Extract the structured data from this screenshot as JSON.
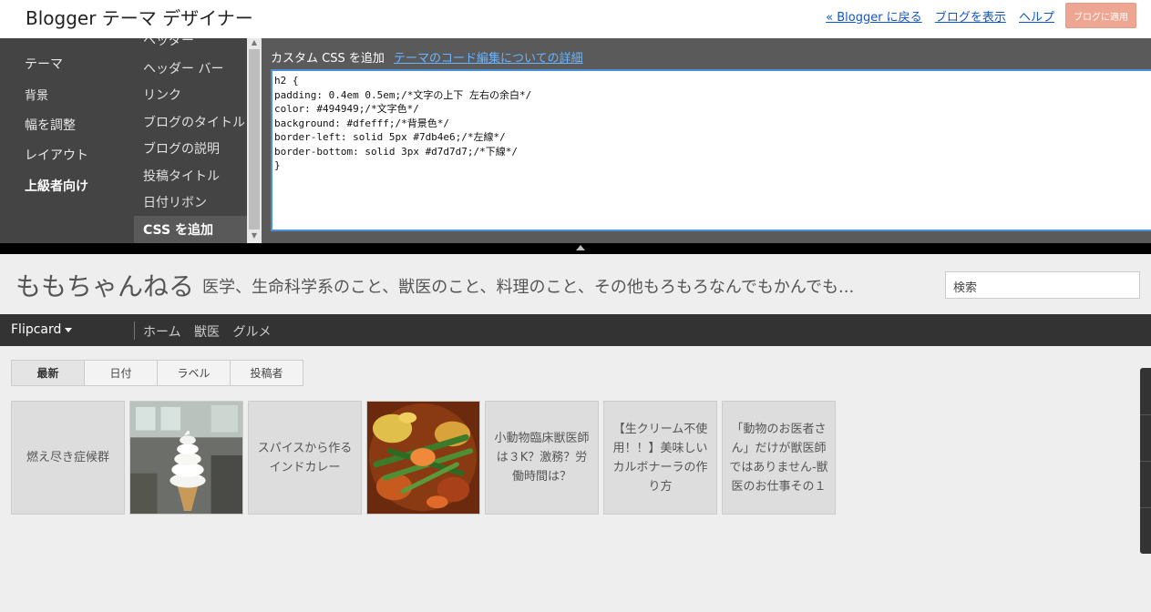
{
  "designer": {
    "app_title": "Blogger テーマ デザイナー",
    "links": [
      "« Blogger に戻る",
      "ブログを表示",
      "ヘルプ"
    ],
    "apply_button": "ブログに適用",
    "nav_primary": [
      "テーマ",
      "背景",
      "幅を調整",
      "レイアウト",
      "上級者向け"
    ],
    "nav_primary_active": "上級者向け",
    "nav_secondary": [
      "ヘッダー",
      "ヘッダー バー",
      "リンク",
      "ブログのタイトル",
      "ブログの説明",
      "投稿タイトル",
      "日付リボン",
      "CSS を追加"
    ],
    "nav_secondary_active": "CSS を追加",
    "css_panel_title": "カスタム CSS を追加",
    "css_help_link": "テーマのコード編集についての詳細",
    "css_code": "h2 {\npadding: 0.4em 0.5em;/*文字の上下 左右の余白*/\ncolor: #494949;/*文字色*/\nbackground: #dfefff;/*背景色*/\nborder-left: solid 5px #7db4e6;/*左線*/\nborder-bottom: solid 3px #d7d7d7;/*下線*/\n}"
  },
  "blog": {
    "title": "ももちゃんねる",
    "description": "医学、生命科学系のこと、獣医のこと、料理のこと、その他もろもろなんでもかんでも...",
    "search_placeholder": "検索",
    "view_selector": "Flipcard",
    "nav_links": [
      "ホーム",
      "獣医",
      "グルメ"
    ],
    "tabs": [
      "最新",
      "日付",
      "ラベル",
      "投稿者"
    ],
    "active_tab": "最新",
    "cards": [
      {
        "type": "text",
        "text": "燃え尽き症候群"
      },
      {
        "type": "image",
        "icon": "soft-serve-ice-cream-image"
      },
      {
        "type": "text",
        "text": "スパイスから作るインドカレー"
      },
      {
        "type": "image",
        "icon": "soup-curry-vegetables-image"
      },
      {
        "type": "text",
        "text": "小動物臨床獣医師は３K？激務？労働時間は？"
      },
      {
        "type": "text",
        "text": "【生クリーム不使用！！】美味しいカルボナーラの作り方"
      },
      {
        "type": "text",
        "text": "「動物のお医者さん」だけが獣医師ではありません-獣医のお仕事その１"
      }
    ]
  },
  "colors": {
    "designer_bg": "#444444",
    "apply_button": "#eea591",
    "link": "#1155cc",
    "editor_border": "#4a90d9",
    "navbar_bg": "#333333"
  }
}
